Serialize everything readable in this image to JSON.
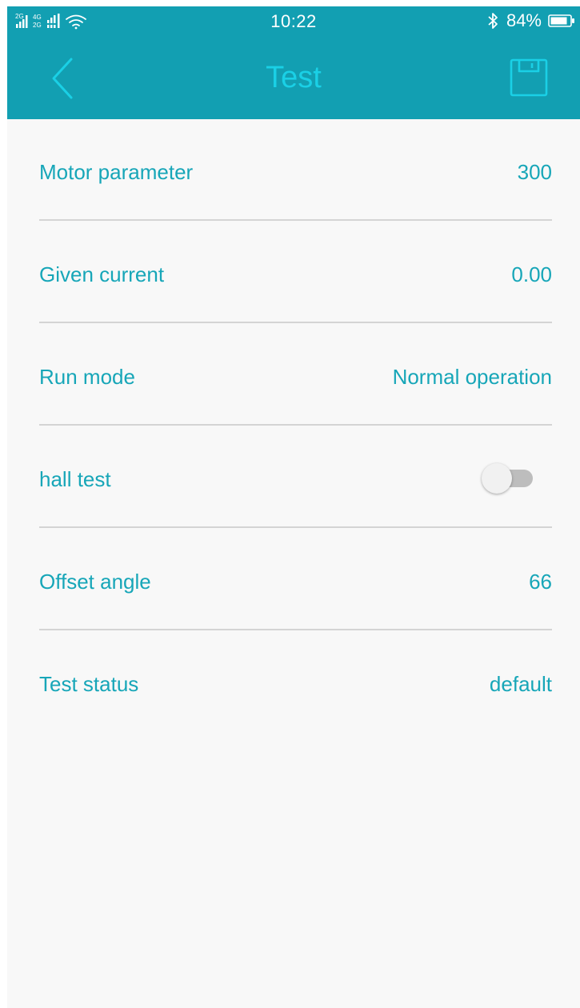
{
  "status_bar": {
    "network_label_1": "2G",
    "network_label_2": "4G",
    "network_label_3": "2G",
    "time": "10:22",
    "battery_percent": "84%",
    "bluetooth_icon": "bluetooth-icon",
    "battery_icon": "battery-icon",
    "wifi_icon": "wifi-icon",
    "signal_icon": "signal-bars-icon"
  },
  "header": {
    "title": "Test",
    "back_icon": "chevron-left-icon",
    "save_icon": "save-floppy-icon"
  },
  "rows": [
    {
      "label": "Motor parameter",
      "value": "300"
    },
    {
      "label": "Given current",
      "value": "0.00"
    },
    {
      "label": "Run mode",
      "value": "Normal operation"
    },
    {
      "label": "hall test",
      "toggle_on": false
    },
    {
      "label": "Offset angle",
      "value": "66"
    },
    {
      "label": "Test status",
      "value": "default"
    }
  ],
  "colors": {
    "header_bg": "#129fb2",
    "title": "#1ad0e6",
    "text_accent": "#17a6b8",
    "page_bg": "#f8f8f8",
    "divider": "#d4d4d4"
  }
}
